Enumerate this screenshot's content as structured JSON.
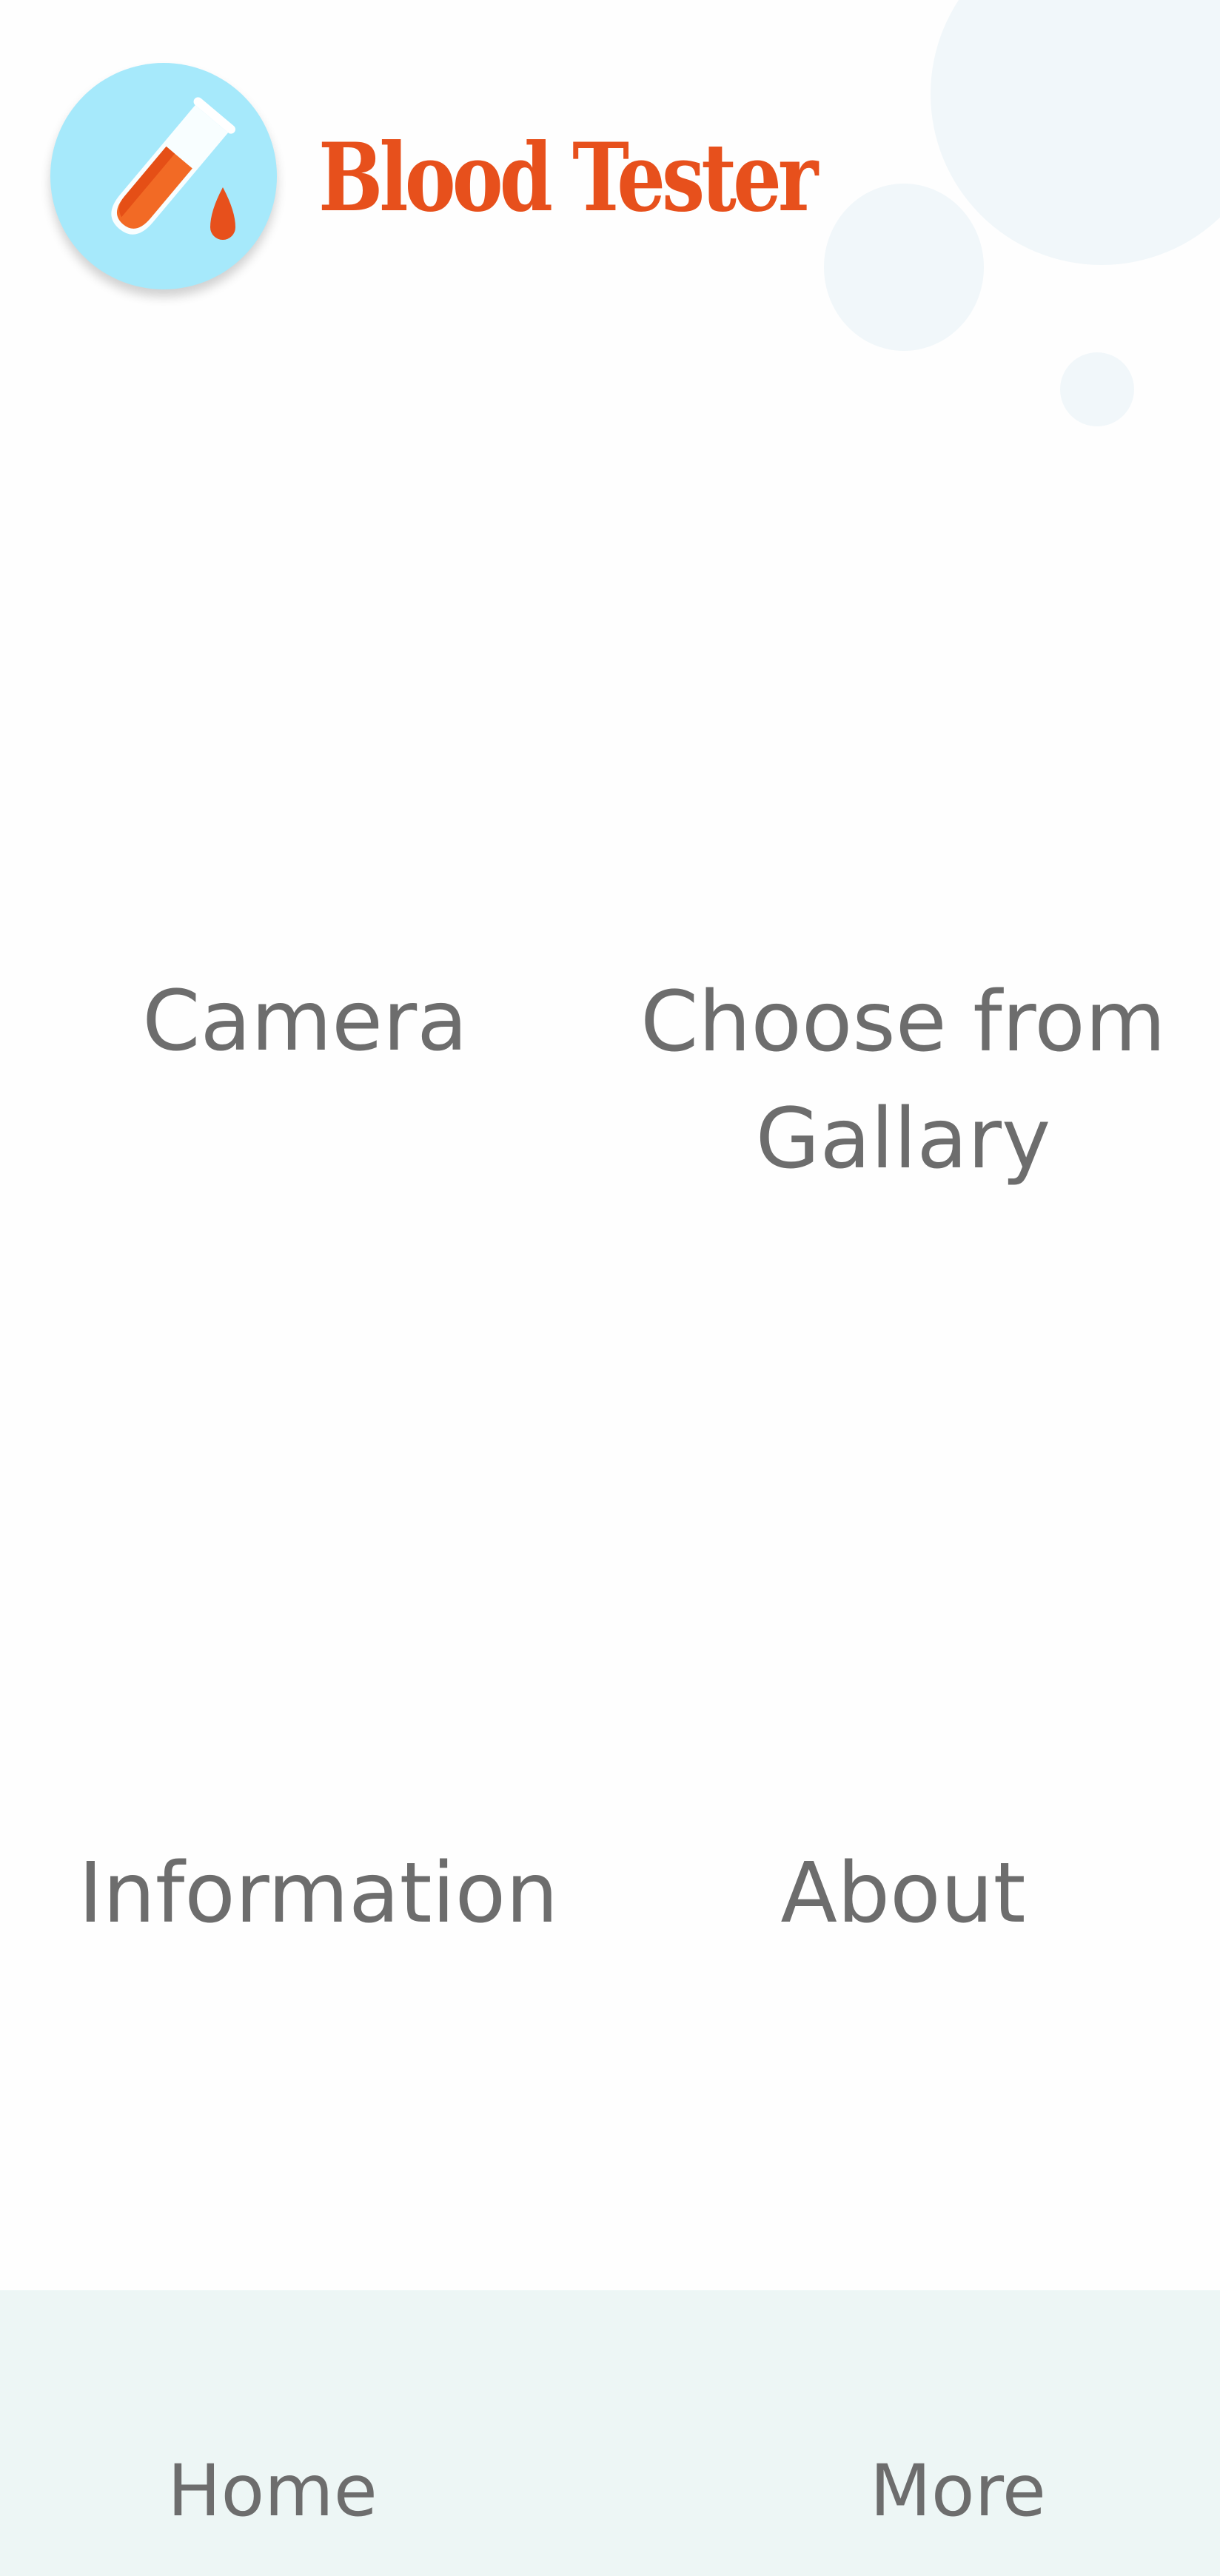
{
  "app": {
    "title": "Blood Tester",
    "logo_icon": "test-tube-blood-drop-icon",
    "colors": {
      "brand": "#e7501c",
      "logo_bg": "#a6e9fb",
      "text": "#6d6d6d",
      "nav_bg": "#edf6f5",
      "bubble": "#f1f7fa"
    }
  },
  "menu": {
    "camera": "Camera",
    "gallery_line1": "Choose from",
    "gallery_line2": "Gallary",
    "information": "Information",
    "about": "About"
  },
  "bottom_nav": {
    "home": "Home",
    "more": "More"
  }
}
